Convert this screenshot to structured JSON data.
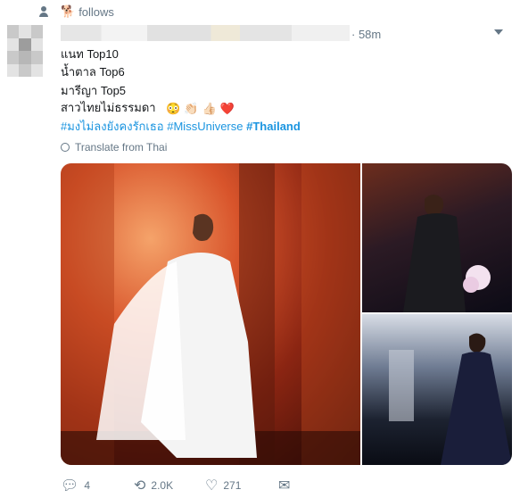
{
  "context": {
    "label": "follows",
    "emoji": "🐕"
  },
  "tweet": {
    "time": "· 58m",
    "lines": [
      "แนท Top10",
      "น้ำตาล Top6",
      "มารีญา Top5",
      "สาวไทยไม่ธรรมดา"
    ],
    "emojis": [
      "😳",
      "👏🏻",
      "👍🏻",
      "❤️"
    ],
    "hashtags": [
      "#มงไม่ลงยังคงรักเธอ",
      "#MissUniverse",
      "#Thailand"
    ],
    "translate": "Translate from Thai",
    "actions": {
      "replies": "4",
      "retweets": "2.0K",
      "likes": "271"
    }
  },
  "colors": {
    "link": "#1b95e0",
    "muted": "#657786",
    "like": "#e0245e"
  }
}
